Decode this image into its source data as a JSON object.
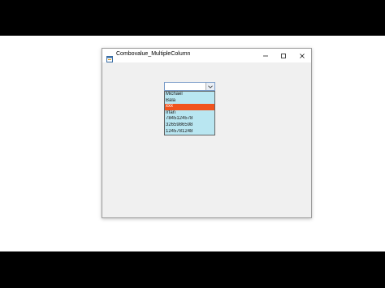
{
  "window": {
    "title": "Combovalue_MultipleColumn"
  },
  "combo": {
    "value": ""
  },
  "dropdown": {
    "items": [
      "Michael",
      "Bala",
      "xxx",
      "Irfan",
      "7845124578",
      "3265986598",
      "1245781248"
    ],
    "selected_index": 2,
    "selected_color": "#f0541e",
    "background_color": "#b9e6f1"
  },
  "icons": {
    "app": "form-icon",
    "minimize": "minimize-icon",
    "maximize": "maximize-icon",
    "close": "close-icon",
    "dropdown": "chevron-down-icon"
  }
}
